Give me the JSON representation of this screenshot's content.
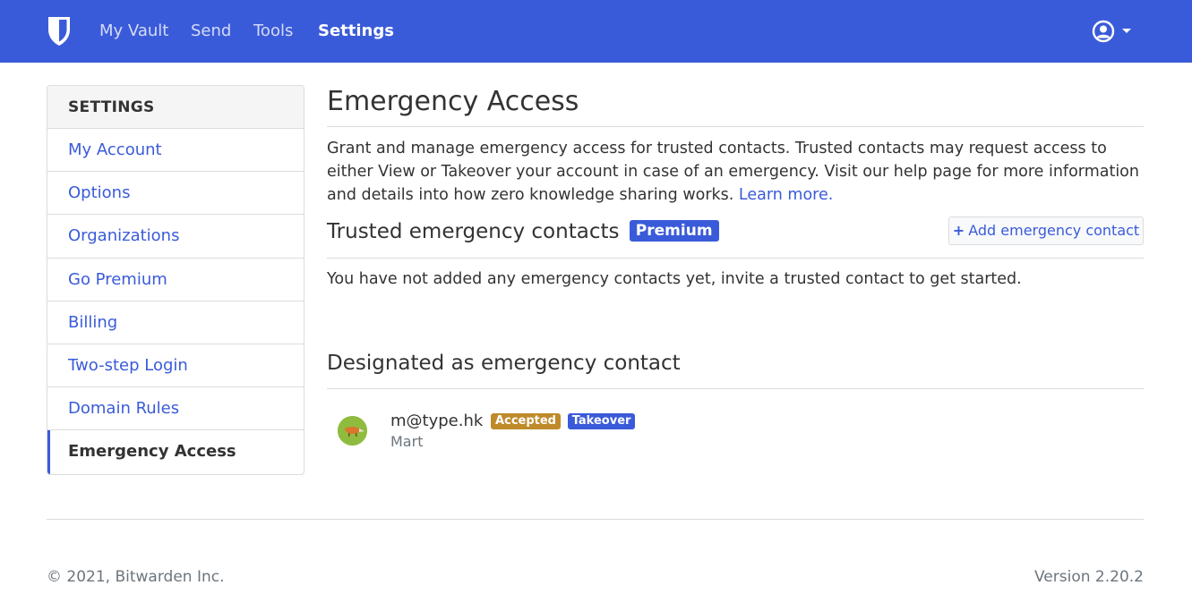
{
  "nav": {
    "brand_icon": "shield-icon",
    "items": [
      {
        "label": "My Vault"
      },
      {
        "label": "Send"
      },
      {
        "label": "Tools"
      },
      {
        "label": "Settings"
      }
    ],
    "active": "Settings",
    "profile_icon": "user-circle-icon",
    "accent_color": "#3a5bd9"
  },
  "sidebar": {
    "header": "SETTINGS",
    "items": [
      {
        "label": "My Account"
      },
      {
        "label": "Options"
      },
      {
        "label": "Organizations"
      },
      {
        "label": "Go Premium"
      },
      {
        "label": "Billing"
      },
      {
        "label": "Two-step Login"
      },
      {
        "label": "Domain Rules"
      },
      {
        "label": "Emergency Access"
      }
    ],
    "active": "Emergency Access"
  },
  "main": {
    "title": "Emergency Access",
    "description": "Grant and manage emergency access for trusted contacts. Trusted contacts may request access to either View or Takeover your account in case of an emergency. Visit our help page for more information and details into how zero knowledge sharing works.",
    "learn_more": "Learn more.",
    "trusted": {
      "title": "Trusted emergency contacts",
      "badge": "Premium",
      "add_button": "Add emergency contact",
      "empty_message": "You have not added any emergency contacts yet, invite a trusted contact to get started."
    },
    "designated": {
      "title": "Designated as emergency contact",
      "contacts": [
        {
          "email": "m@type.hk",
          "status": "Accepted",
          "type": "Takeover",
          "name": "Mart"
        }
      ]
    }
  },
  "footer": {
    "copyright": "© 2021, Bitwarden Inc.",
    "version": "Version 2.20.2"
  }
}
